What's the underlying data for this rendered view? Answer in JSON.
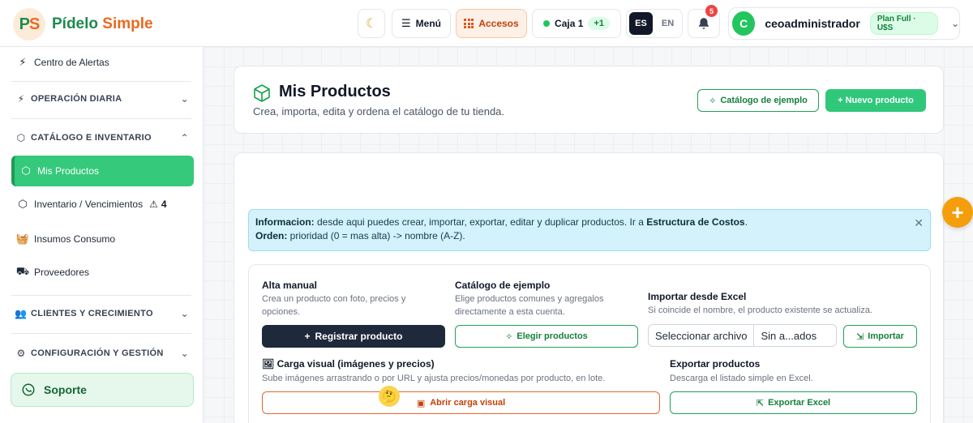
{
  "brand": {
    "name_part1": "Pídelo",
    "name_part2": "Simple",
    "badge_p": "P",
    "badge_s": "S"
  },
  "header": {
    "menu_label": "Menú",
    "accesos_label": "Accesos",
    "caja_label": "Caja 1",
    "caja_badge": "+1",
    "lang_es": "ES",
    "lang_en": "EN",
    "notifications_count": "5",
    "user_initial": "C",
    "user_name": "ceoadministrador",
    "plan_label": "Plan Full · U$S"
  },
  "sidebar": {
    "alert_center": "Centro de Alertas",
    "section_operacion": "OPERACIÓN DIARIA",
    "section_catalogo": "CATÁLOGO E INVENTARIO",
    "item_mis_productos": "Mis Productos",
    "item_inventario": "Inventario / Vencimientos",
    "inventario_warning_count": "4",
    "item_insumos": "Insumos Consumo",
    "item_proveedores": "Proveedores",
    "section_clientes": "CLIENTES Y CRECIMIENTO",
    "section_config": "CONFIGURACIÓN Y GESTIÓN",
    "support_label": "Soporte"
  },
  "page": {
    "title": "Mis Productos",
    "subtitle": "Crea, importa, edita y ordena el catálogo de tu tienda.",
    "btn_catalogo": "Catálogo de ejemplo",
    "btn_nuevo": "+ Nuevo producto"
  },
  "info": {
    "label1": "Informacion:",
    "text1": " desde aqui puedes crear, importar, exportar, editar y duplicar productos. Ir a ",
    "link1": "Estructura de Costos",
    "text1_end": ".",
    "label2": "Orden:",
    "text2": " prioridad (0 = mas alta) -> nombre (A-Z)."
  },
  "actions": {
    "alta_title": "Alta manual",
    "alta_desc": "Crea un producto con foto, precios y opciones.",
    "alta_btn": "Registrar producto",
    "catalogo_title": "Catálogo de ejemplo",
    "catalogo_desc": "Elige productos comunes y agregalos directamente a esta cuenta.",
    "catalogo_btn": "Elegir productos",
    "importar_title": "Importar desde Excel",
    "importar_desc": "Si coincide el nombre, el producto existente se actualiza.",
    "file_btn": "Seleccionar archivo",
    "file_name": "Sin a...ados",
    "importar_btn": "Importar",
    "carga_title": "Carga visual (imágenes y precios)",
    "carga_desc": "Sube imágenes arrastrando o por URL y ajusta precios/monedas por producto, en lote.",
    "carga_btn": "Abrir carga visual",
    "exportar_title": "Exportar productos",
    "exportar_desc": "Descarga el listado simple en Excel.",
    "exportar_btn": "Exportar Excel"
  }
}
